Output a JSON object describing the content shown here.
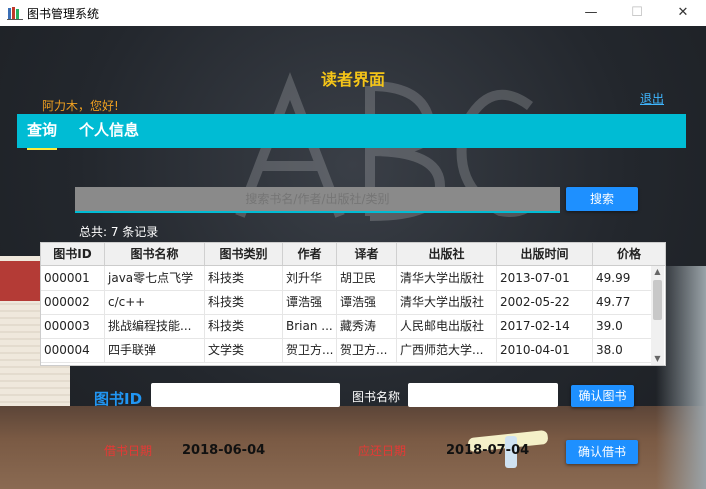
{
  "window": {
    "title": "图书管理系统",
    "icon": "books-app-icon",
    "controls": {
      "minimize": "—",
      "maximize": "☐",
      "close": "✕"
    }
  },
  "page": {
    "title": "读者界面",
    "greeting": "阿力木，您好!",
    "logout_label": "退出"
  },
  "nav": {
    "tabs": [
      {
        "label": "查询",
        "active": true
      },
      {
        "label": "个人信息",
        "active": false
      }
    ]
  },
  "search": {
    "placeholder": "搜索书名/作者/出版社/类别",
    "button_label": "搜索"
  },
  "summary": {
    "text": "总共:  7 条记录"
  },
  "table": {
    "columns": [
      "图书ID",
      "图书名称",
      "图书类别",
      "作者",
      "译者",
      "出版社",
      "出版时间",
      "价格"
    ],
    "rows": [
      [
        "000001",
        "java零七点飞学",
        "科技类",
        "刘升华",
        "胡卫民",
        "清华大学出版社",
        "2013-07-01",
        "49.99"
      ],
      [
        "000002",
        "c/c++",
        "科技类",
        "谭浩强",
        "谭浩强",
        "清华大学出版社",
        "2002-05-22",
        "49.77"
      ],
      [
        "000003",
        "挑战编程技能...",
        "科技类",
        "Brian ...",
        "藏秀涛",
        "人民邮电出版社",
        "2017-02-14",
        "39.0"
      ],
      [
        "000004",
        "四手联弹",
        "文学类",
        "贺卫方...",
        "贺卫方...",
        "广西师范大学...",
        "2010-04-01",
        "38.0"
      ]
    ]
  },
  "borrow_form": {
    "book_id_label": "图书ID",
    "book_id_value": "",
    "book_name_label": "图书名称",
    "book_name_value": "",
    "confirm_book_label": "确认图书",
    "borrow_date_label": "借书日期",
    "borrow_date": "2018-06-04",
    "due_date_label": "应还日期",
    "due_date": "2018-07-04",
    "confirm_borrow_label": "确认借书"
  },
  "colors": {
    "accent": "#00bcd4",
    "title_yellow": "#f5c518",
    "button_blue": "#1e90ff",
    "label_red": "#e53935"
  }
}
